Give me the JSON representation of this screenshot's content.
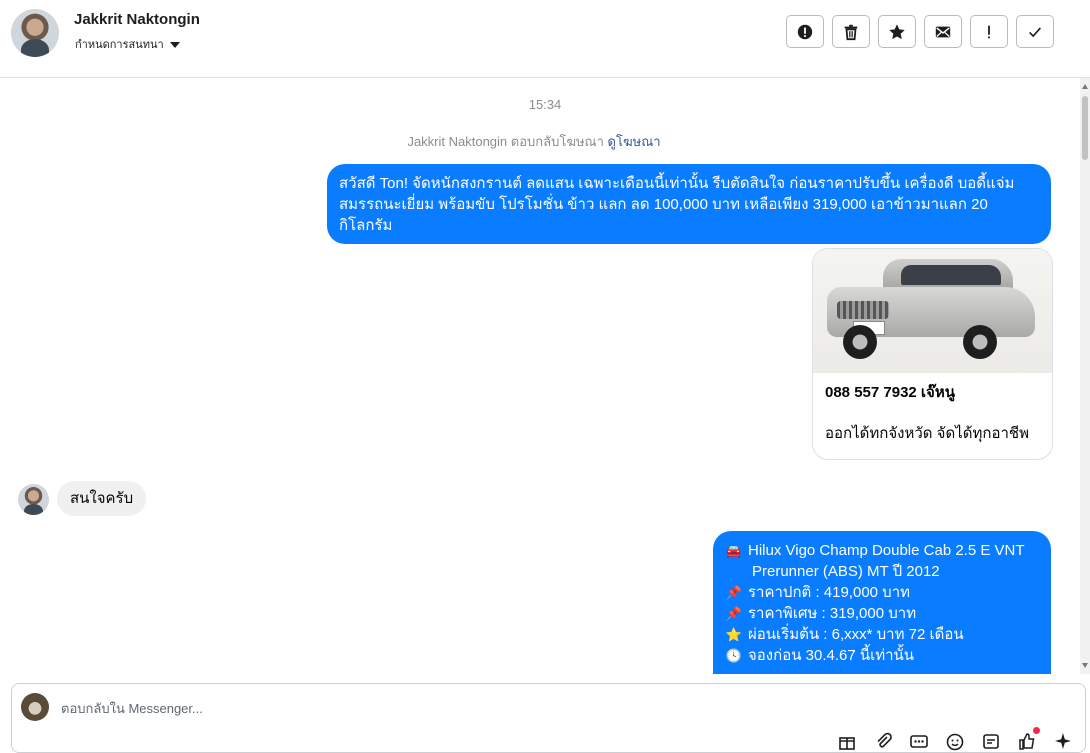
{
  "header": {
    "name": "Jakkrit Naktongin",
    "subtitle": "กำหนดการสนทนา",
    "actions": [
      "spam-icon",
      "trash-icon",
      "star-icon",
      "envelope-icon",
      "exclamation-icon",
      "check-icon"
    ]
  },
  "thread": {
    "timestamp": "15:34",
    "ad_reply_text": "Jakkrit Naktongin ตอบกลับโฆษณา",
    "ad_link": "ดูโฆษณา",
    "msg1": "สวัสดี Ton!  จัดหนักสงกรานต์ ลดแสน เฉพาะเดือนนี้เท่านั้น รีบตัดสินใจ ก่อนราคาปรับขึ้น เครื่องดี บอดี้แจ่ม สมรรถนะเยี่ยม พร้อมขับ โปรโมชั่น ข้าว แลก ลด 100,000 บาท เหลือเพียง 319,000 เอาข้าวมาแลก 20 กิโลกรัม",
    "card": {
      "title": "088 557 7932 เจ๊หนู",
      "description": "ออกได้ทกจังหวัด จัดได้ทุกอาชีพ"
    },
    "reply": "สนใจครับ",
    "msg2": {
      "line1": "Hilux Vigo Champ Double Cab 2.5 E VNT",
      "line1b": "Prerunner (ABS) MT ปี 2012",
      "line2": "ราคาปกติ : 419,000 บาท",
      "line3": "ราคาพิเศษ : 319,000 บาท",
      "line4": "ผ่อนเริ่มต้น : 6,xxx* บาท 72 เดือน",
      "line5": "จองก่อน 30.4.67 นี้เท่านั้น"
    }
  },
  "composer": {
    "placeholder": "ตอบกลับใน Messenger..."
  },
  "colors": {
    "outgoing_bubble": "#0a7cff",
    "incoming_bubble": "#f0f0f0",
    "notification_dot": "#f02849"
  }
}
